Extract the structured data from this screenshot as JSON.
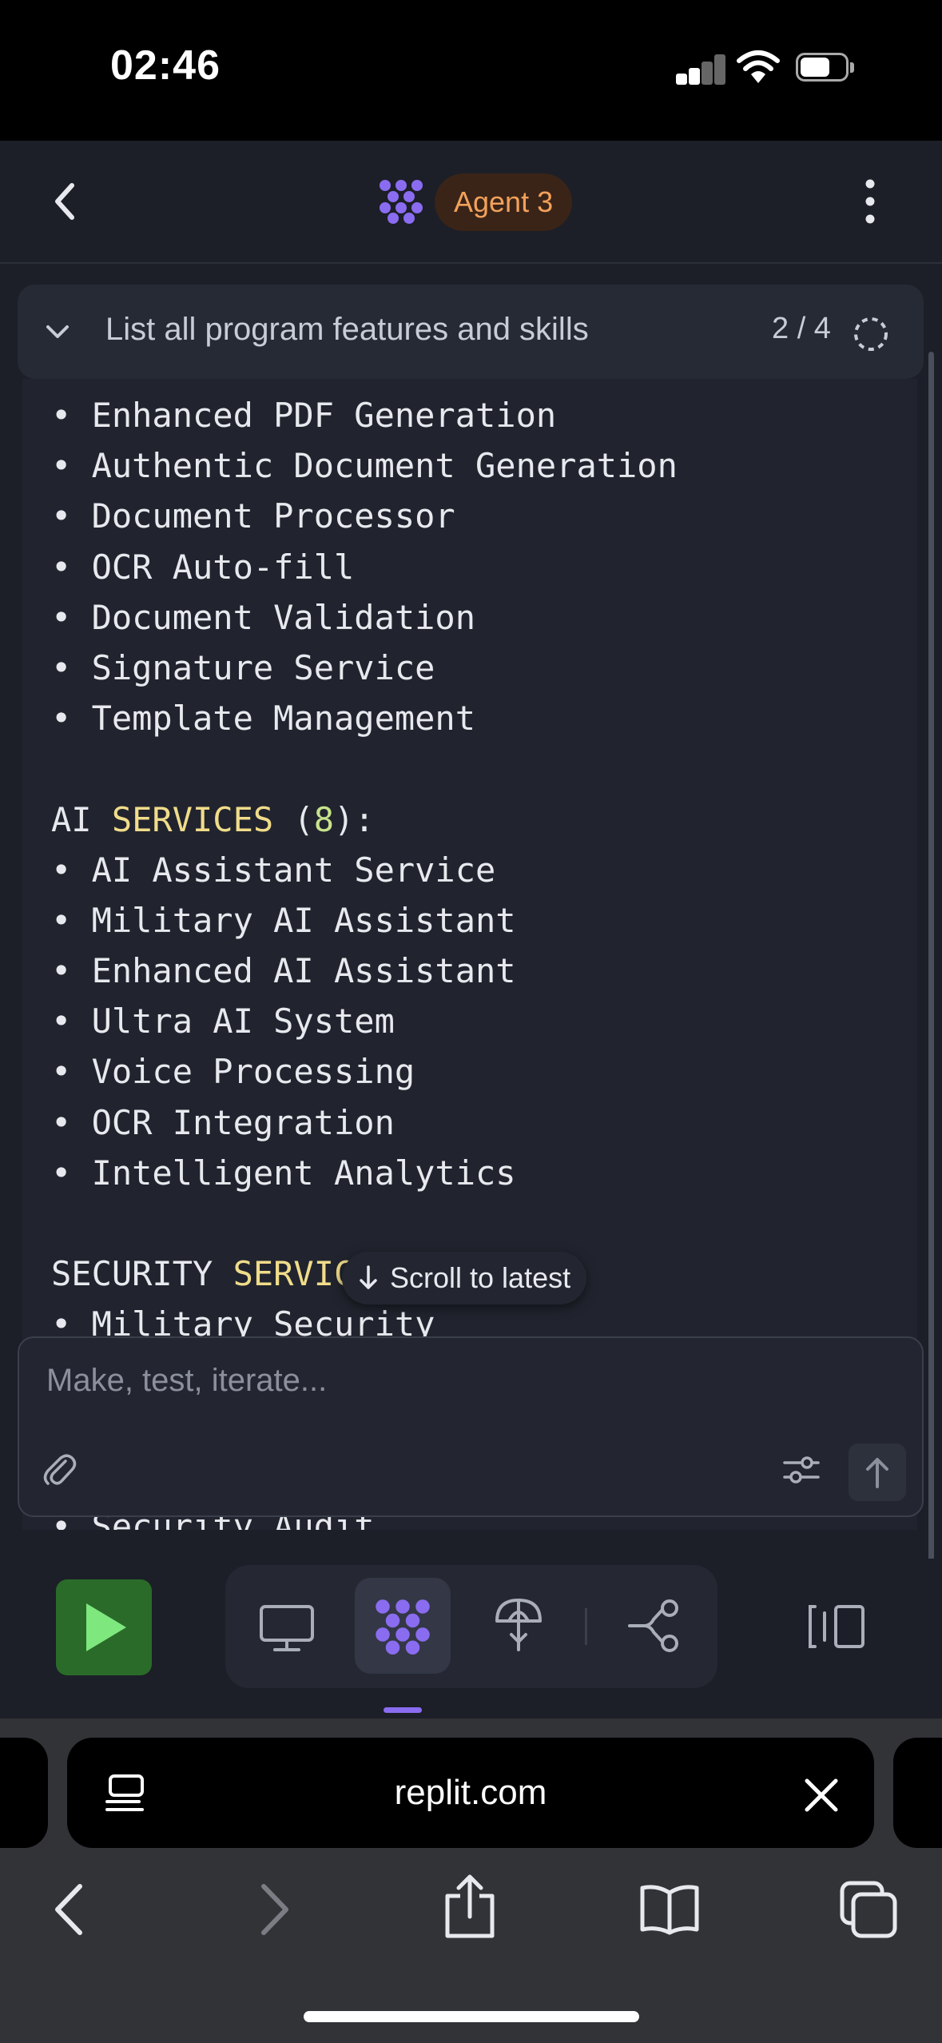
{
  "status_bar": {
    "time": "02:46"
  },
  "header": {
    "agent_label": "Agent 3"
  },
  "task": {
    "title": "List all program features and skills",
    "counter": "2 / 4"
  },
  "log": {
    "lines": [
      "• Enhanced PDF Generation",
      "• Authentic Document Generation",
      "• Document Processor",
      "• OCR Auto-fill",
      "• Document Validation",
      "• Signature Service",
      "• Template Management",
      "",
      "AI SERVICES (8):",
      "• AI Assistant Service",
      "• Military AI Assistant",
      "• Enhanced AI Assistant",
      "• Ultra AI System",
      "• Voice Processing",
      "• OCR Integration",
      "• Intelligent Analytics",
      "",
      "SECURITY SERVIC",
      "• Military Security",
      "",
      "",
      "",
      "• Security Audit"
    ]
  },
  "scroll_latest_label": "Scroll to latest",
  "composer": {
    "placeholder": "Make, test, iterate..."
  },
  "browser": {
    "url": "replit.com"
  },
  "colors": {
    "accent": "#8a6cf0",
    "run_green": "#2a6b2a",
    "badge_text": "#f2a15b",
    "keyword": "#f0dc8a"
  }
}
